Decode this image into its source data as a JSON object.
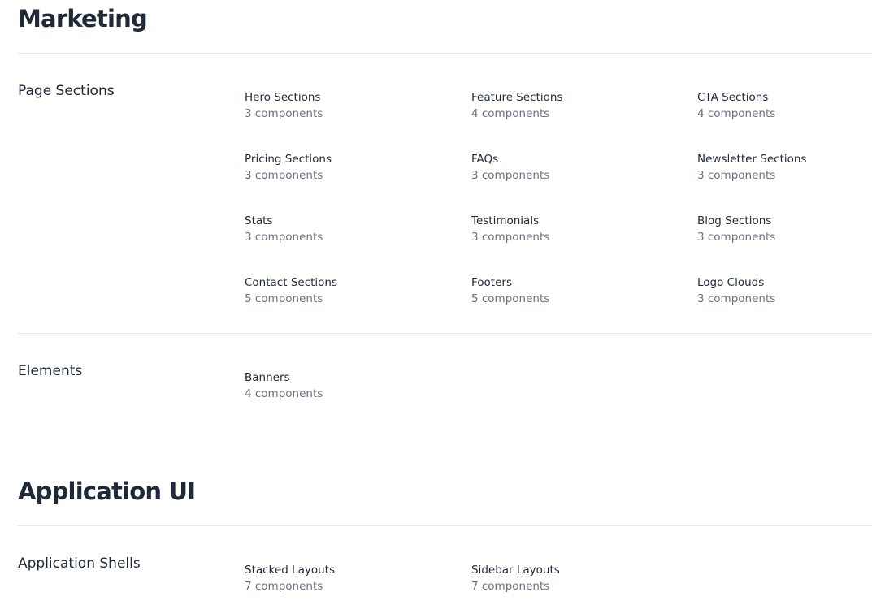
{
  "groups": [
    {
      "title": "Marketing",
      "sections": [
        {
          "label": "Page Sections",
          "items": [
            {
              "name": "Hero Sections",
              "count": "3 components"
            },
            {
              "name": "Feature Sections",
              "count": "4 components"
            },
            {
              "name": "CTA Sections",
              "count": "4 components"
            },
            {
              "name": "Pricing Sections",
              "count": "3 components"
            },
            {
              "name": "FAQs",
              "count": "3 components"
            },
            {
              "name": "Newsletter Sections",
              "count": "3 components"
            },
            {
              "name": "Stats",
              "count": "3 components"
            },
            {
              "name": "Testimonials",
              "count": "3 components"
            },
            {
              "name": "Blog Sections",
              "count": "3 components"
            },
            {
              "name": "Contact Sections",
              "count": "5 components"
            },
            {
              "name": "Footers",
              "count": "5 components"
            },
            {
              "name": "Logo Clouds",
              "count": "3 components"
            }
          ]
        },
        {
          "label": "Elements",
          "items": [
            {
              "name": "Banners",
              "count": "4 components"
            }
          ]
        }
      ]
    },
    {
      "title": "Application UI",
      "sections": [
        {
          "label": "Application Shells",
          "items": [
            {
              "name": "Stacked Layouts",
              "count": "7 components"
            },
            {
              "name": "Sidebar Layouts",
              "count": "7 components"
            }
          ]
        }
      ]
    }
  ]
}
